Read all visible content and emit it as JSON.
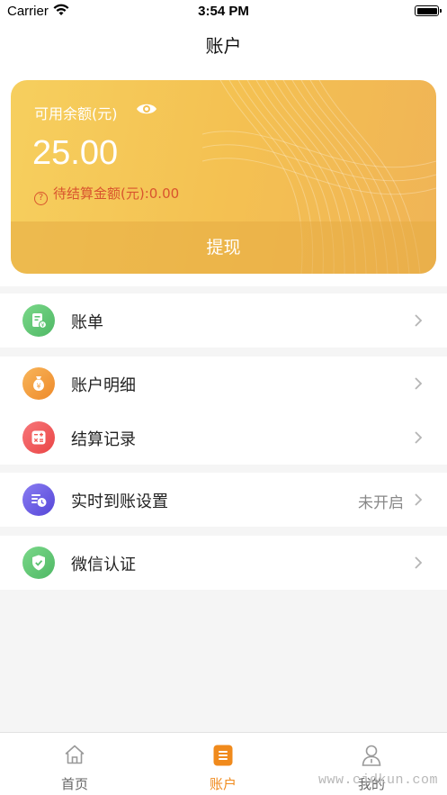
{
  "status_bar": {
    "carrier": "Carrier",
    "time": "3:54 PM"
  },
  "header": {
    "title": "账户"
  },
  "balance_card": {
    "label": "可用余额(元)",
    "amount": "25.00",
    "pending": "待结算金额(元):0.00",
    "withdraw_label": "提现"
  },
  "menu": {
    "bill": {
      "label": "账单",
      "icon": "bill-icon",
      "color": "#5cc271"
    },
    "account_detail": {
      "label": "账户明细",
      "icon": "money-bag-icon",
      "color": "#f29a3a"
    },
    "settlement": {
      "label": "结算记录",
      "icon": "calculator-icon",
      "color": "#f05a55"
    },
    "realtime": {
      "label": "实时到账设置",
      "value": "未开启",
      "icon": "clock-icon",
      "color": "#6b5ee8"
    },
    "wechat": {
      "label": "微信认证",
      "icon": "shield-check-icon",
      "color": "#5cc271"
    }
  },
  "tab_bar": {
    "home": {
      "label": "首页",
      "icon": "home-icon"
    },
    "account": {
      "label": "账户",
      "icon": "account-list-icon",
      "active": true,
      "color": "#f08a1c"
    },
    "mine": {
      "label": "我的",
      "icon": "user-icon"
    }
  },
  "watermark": "www.cjdkun.com"
}
